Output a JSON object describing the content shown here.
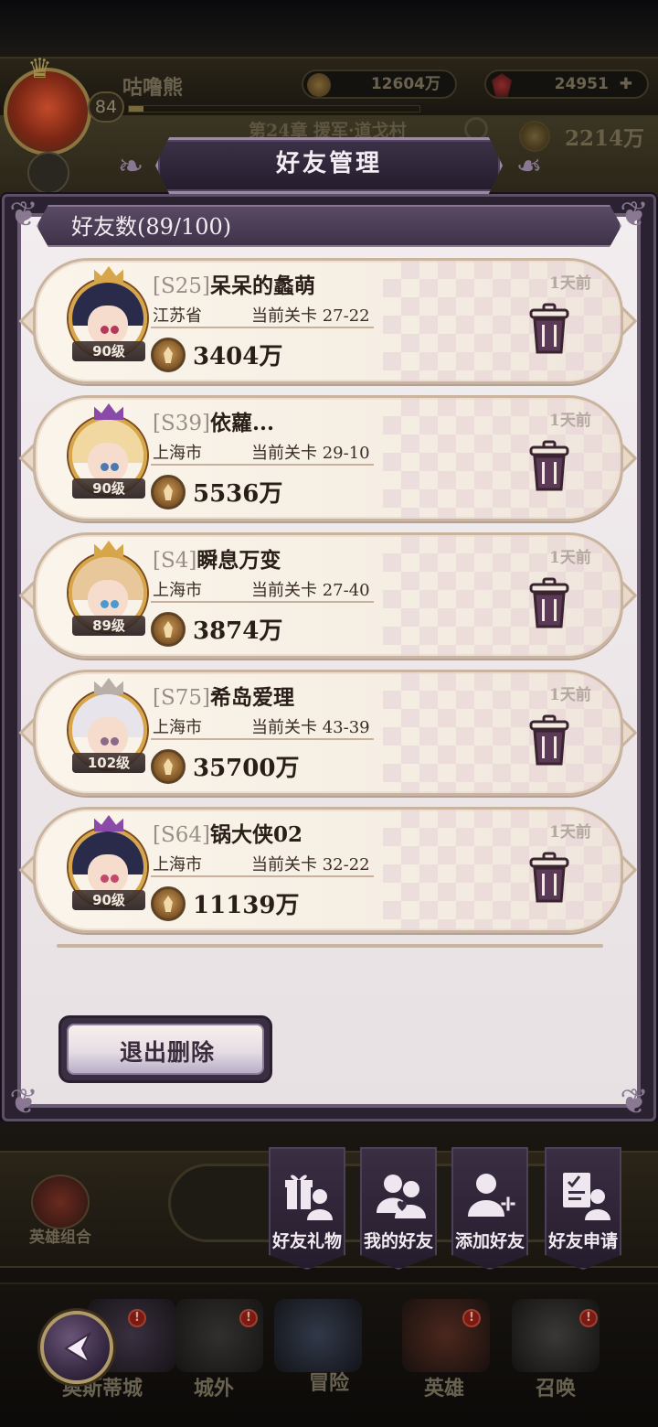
{
  "background": {
    "player_name": "咕噜熊",
    "player_level": "84",
    "exp_progress": 0.05,
    "gold": "12604万",
    "gems": "24951",
    "chapter": "第24章 援军·道戈村",
    "power": "2214万",
    "hero_combo": "英雄组合"
  },
  "dialog": {
    "title": "好友管理",
    "friend_count": "好友数(89/100)",
    "exit_delete": "退出删除"
  },
  "friends": [
    {
      "server": "[S25]",
      "name": "呆呆的蠡萌",
      "city": "江苏省",
      "stage": "当前关卡 27-22",
      "power": "3404万",
      "level": "90级",
      "time": "1天前",
      "hair": "#2a2a4a",
      "eye": "#b43a5a",
      "crown": "#d8a64a"
    },
    {
      "server": "[S39]",
      "name": "依蘿...",
      "city": "上海市",
      "stage": "当前关卡 29-10",
      "power": "5536万",
      "level": "90级",
      "time": "1天前",
      "hair": "#f0d8a0",
      "eye": "#4a7ab4",
      "crown": "#8a4aa8"
    },
    {
      "server": "[S4]",
      "name": "瞬息万变",
      "city": "上海市",
      "stage": "当前关卡 27-40",
      "power": "3874万",
      "level": "89级",
      "time": "1天前",
      "hair": "#e8c89a",
      "eye": "#4a9ad0",
      "crown": "#d8a64a"
    },
    {
      "server": "[S75]",
      "name": "希岛爱理",
      "city": "上海市",
      "stage": "当前关卡 43-39",
      "power": "35700万",
      "level": "102级",
      "time": "1天前",
      "hair": "#e8e4ec",
      "eye": "#8a6a8a",
      "crown": "#b8b0a8"
    },
    {
      "server": "[S64]",
      "name": "锅大侠02",
      "city": "上海市",
      "stage": "当前关卡 32-22",
      "power": "11139万",
      "level": "90级",
      "time": "1天前",
      "hair": "#2a2a4a",
      "eye": "#c4486a",
      "crown": "#8a4aa8"
    }
  ],
  "tabs": [
    {
      "label": "好友礼物",
      "icon": "gift-friend-icon"
    },
    {
      "label": "我的好友",
      "icon": "my-friends-icon"
    },
    {
      "label": "添加好友",
      "icon": "add-friend-icon"
    },
    {
      "label": "好友申请",
      "icon": "friend-request-icon"
    }
  ],
  "nav": [
    {
      "label": "奥斯蒂城"
    },
    {
      "label": "城外"
    },
    {
      "label": "冒险"
    },
    {
      "label": "英雄"
    },
    {
      "label": "召唤"
    }
  ],
  "nav_badge": "!"
}
